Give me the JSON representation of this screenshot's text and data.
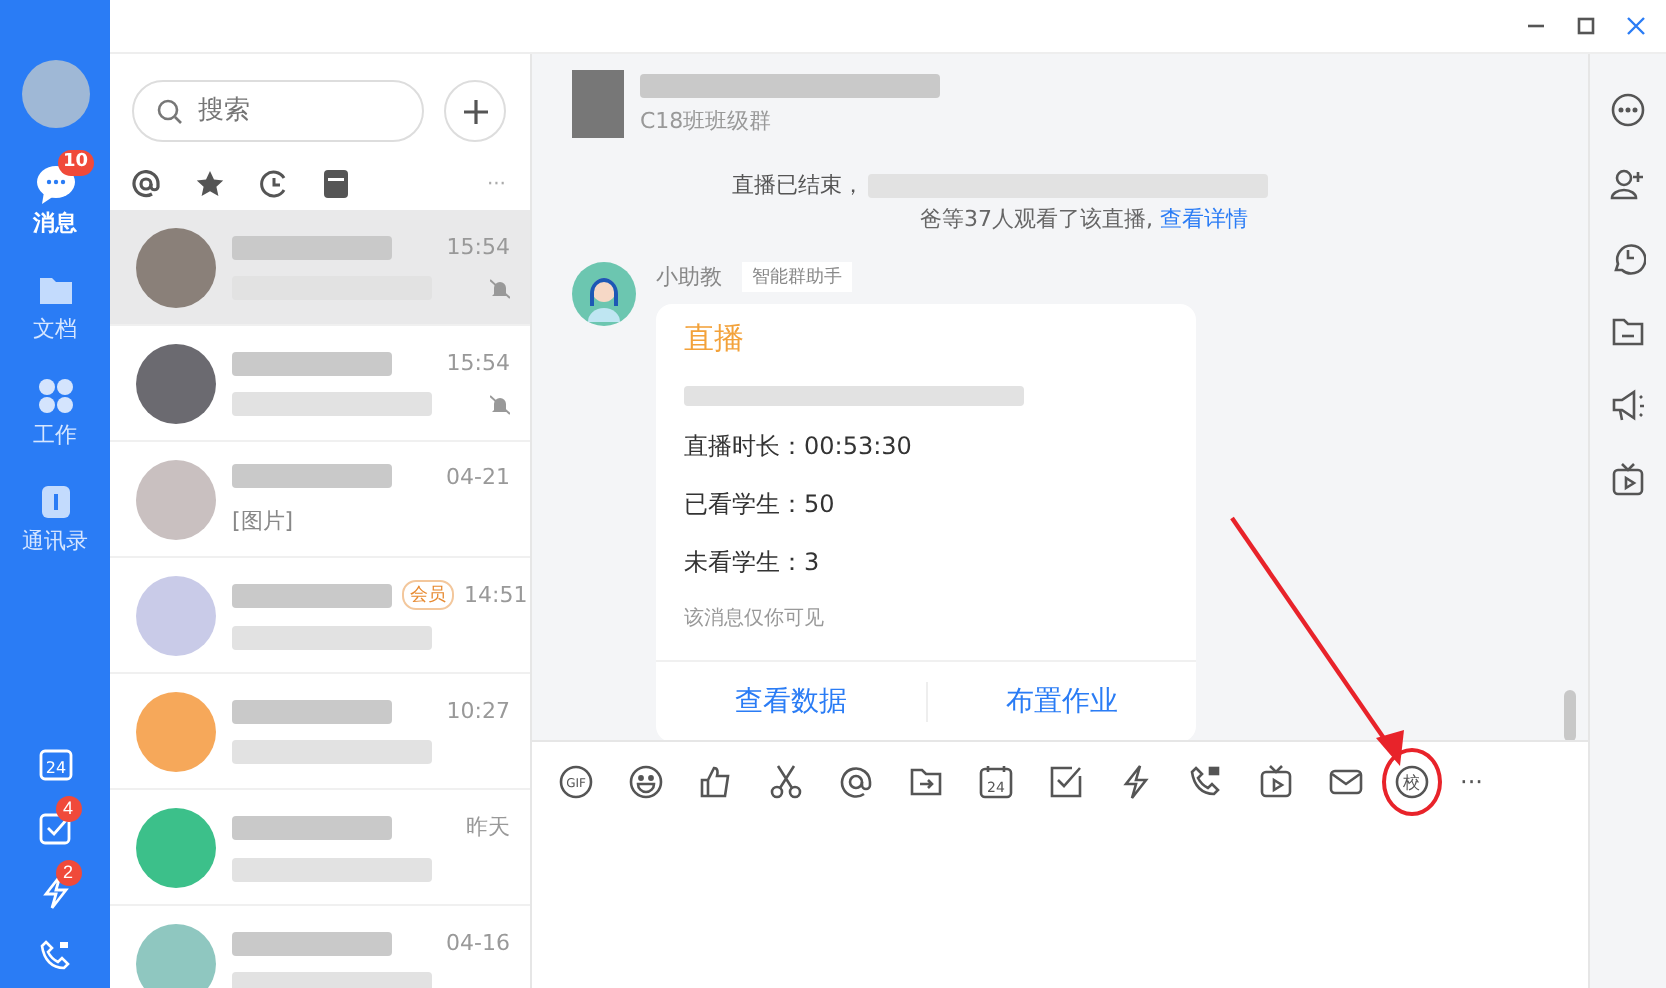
{
  "rail": {
    "nav": [
      {
        "kind": "chat",
        "label": "消息",
        "badge": "10",
        "selected": true
      },
      {
        "kind": "docs",
        "label": "文档",
        "selected": false
      },
      {
        "kind": "work",
        "label": "工作",
        "selected": false
      },
      {
        "kind": "contacts",
        "label": "通讯录",
        "selected": false
      }
    ],
    "tools": [
      {
        "kind": "calendar",
        "label": "24"
      },
      {
        "kind": "task",
        "badge": "4"
      },
      {
        "kind": "flash",
        "badge": "2"
      },
      {
        "kind": "call"
      }
    ]
  },
  "search": {
    "placeholder": "搜索"
  },
  "filters": [
    {
      "kind": "at"
    },
    {
      "kind": "star"
    },
    {
      "kind": "clock"
    },
    {
      "kind": "archive"
    },
    {
      "kind": "more",
      "label": "···"
    }
  ],
  "conversations": [
    {
      "time": "15:54",
      "selected": true,
      "muted": true
    },
    {
      "time": "15:54",
      "selected": false,
      "muted": true
    },
    {
      "time": "04-21",
      "selected": false,
      "muted": false,
      "preview": "[图片]"
    },
    {
      "time": "14:51",
      "selected": false,
      "muted": false,
      "tag": "会员"
    },
    {
      "time": "10:27",
      "selected": false,
      "muted": false
    },
    {
      "time": "昨天",
      "selected": false,
      "muted": false
    },
    {
      "time": "04-16",
      "selected": false,
      "muted": false
    }
  ],
  "chat": {
    "subtitle": "C18班班级群",
    "system_line": "直播已结束，",
    "system_line_2": "爸等37人观看了该直播,",
    "system_link": "查看详情",
    "message": {
      "sender": "小助教",
      "badge": "智能群助手",
      "title": "直播",
      "stats": [
        "直播时长：00:53:30",
        "已看学生：50",
        "未看学生：3"
      ],
      "note": "该消息仅你可见",
      "actions": [
        "查看数据",
        "布置作业"
      ]
    }
  },
  "toolbar": [
    {
      "kind": "gif",
      "label": "GIF",
      "highlighted": false
    },
    {
      "kind": "emoji",
      "highlighted": false
    },
    {
      "kind": "like",
      "highlighted": false
    },
    {
      "kind": "cut",
      "highlighted": false
    },
    {
      "kind": "at",
      "highlighted": false
    },
    {
      "kind": "file",
      "highlighted": false
    },
    {
      "kind": "calendar",
      "label": "24",
      "highlighted": false
    },
    {
      "kind": "check",
      "highlighted": false
    },
    {
      "kind": "flash",
      "highlighted": false
    },
    {
      "kind": "call",
      "highlighted": false
    },
    {
      "kind": "tv",
      "highlighted": false
    },
    {
      "kind": "mail",
      "highlighted": false
    },
    {
      "kind": "school",
      "label": "校",
      "highlighted": true
    },
    {
      "kind": "more",
      "label": "···",
      "highlighted": false
    }
  ],
  "side": [
    {
      "kind": "more"
    },
    {
      "kind": "add-person"
    },
    {
      "kind": "history"
    },
    {
      "kind": "folder"
    },
    {
      "kind": "megaphone"
    },
    {
      "kind": "tv"
    }
  ]
}
